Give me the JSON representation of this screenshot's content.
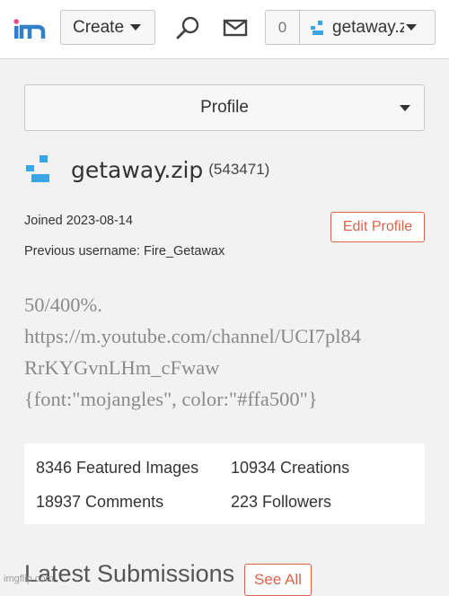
{
  "header": {
    "logo_text": "im",
    "create_label": "Create",
    "search_icon": "search-icon",
    "mail_icon": "mail-icon",
    "notification_count": "0",
    "username": "getaway.zip"
  },
  "profile_select": {
    "selected": "Profile"
  },
  "user": {
    "name": "getaway.zip",
    "id": "(543471)",
    "joined": "Joined 2023-08-14",
    "previous_username": "Previous username: Fire_Getawax",
    "edit_label": "Edit Profile",
    "bio_lines": [
      "50/400%.",
      "https://m.youtube.com/channel/UCI7pl84",
      "RrKYGvnLHm_cFwaw",
      "{font:\"mojangles\", color:\"#ffa500\"}"
    ]
  },
  "stats": {
    "featured": "8346 Featured Images",
    "creations": "10934 Creations",
    "comments": "18937 Comments",
    "followers": "223 Followers"
  },
  "latest": {
    "title": "Latest Submissions",
    "see_all": "See All"
  },
  "watermark": "imgflip.com",
  "colors": {
    "accent": "#e0624a",
    "avatar_blue": "#3aa6e8",
    "logo_blue": "#2f80c9",
    "logo_pink": "#e64a8b"
  }
}
